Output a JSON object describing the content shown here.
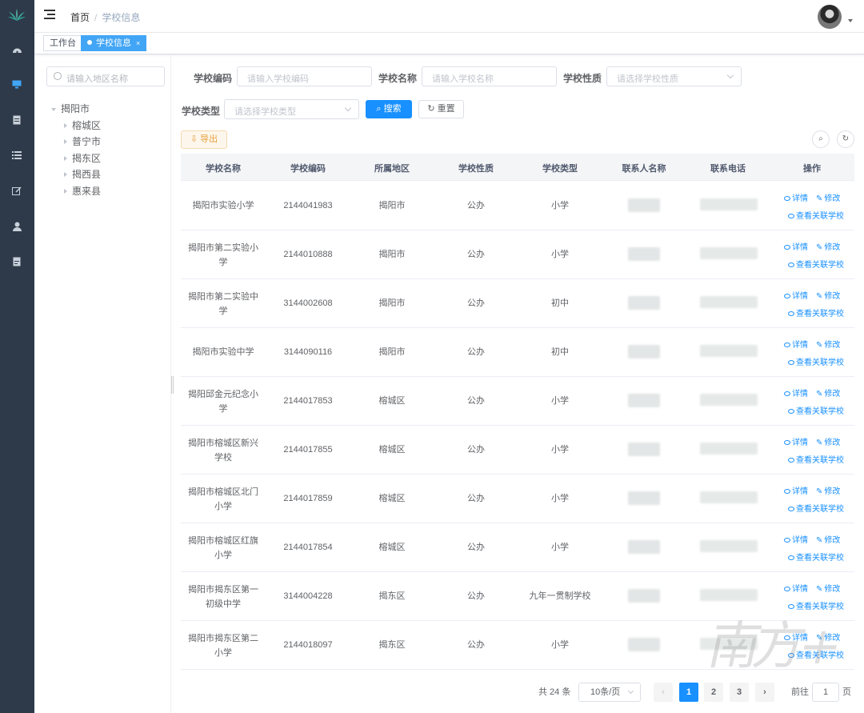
{
  "sidebar_nav": {
    "icons": [
      "dashboard-icon",
      "monitor-icon",
      "document-icon",
      "list-icon",
      "edit-icon",
      "user-icon",
      "file-icon"
    ]
  },
  "header": {
    "breadcrumb": [
      "首页",
      "学校信息"
    ]
  },
  "tags": [
    {
      "label": "工作台",
      "active": false
    },
    {
      "label": "学校信息",
      "active": true
    }
  ],
  "tree": {
    "search_placeholder": "请输入地区名称",
    "root": "揭阳市",
    "children": [
      "榕城区",
      "普宁市",
      "揭东区",
      "揭西县",
      "惠来县"
    ]
  },
  "filters": {
    "code_label": "学校编码",
    "code_placeholder": "请输入学校编码",
    "name_label": "学校名称",
    "name_placeholder": "请输入学校名称",
    "nature_label": "学校性质",
    "nature_placeholder": "请选择学校性质",
    "type_label": "学校类型",
    "type_placeholder": "请选择学校类型",
    "search_button": "搜索",
    "reset_button": "重置",
    "export_button": "导出"
  },
  "table": {
    "headers": [
      "学校名称",
      "学校编码",
      "所属地区",
      "学校性质",
      "学校类型",
      "联系人名称",
      "联系电话",
      "操作"
    ],
    "actions": {
      "detail": "详情",
      "edit": "修改",
      "related": "查看关联学校"
    },
    "rows": [
      {
        "name": "揭阳市实验小学",
        "code": "2144041983",
        "region": "揭阳市",
        "nature": "公办",
        "type": "小学"
      },
      {
        "name": "揭阳市第二实验小学",
        "code": "2144010888",
        "region": "揭阳市",
        "nature": "公办",
        "type": "小学"
      },
      {
        "name": "揭阳市第二实验中学",
        "code": "3144002608",
        "region": "揭阳市",
        "nature": "公办",
        "type": "初中"
      },
      {
        "name": "揭阳市实验中学",
        "code": "3144090116",
        "region": "揭阳市",
        "nature": "公办",
        "type": "初中"
      },
      {
        "name": "揭阳邱金元纪念小学",
        "code": "2144017853",
        "region": "榕城区",
        "nature": "公办",
        "type": "小学"
      },
      {
        "name": "揭阳市榕城区新兴学校",
        "code": "2144017855",
        "region": "榕城区",
        "nature": "公办",
        "type": "小学"
      },
      {
        "name": "揭阳市榕城区北门小学",
        "code": "2144017859",
        "region": "榕城区",
        "nature": "公办",
        "type": "小学"
      },
      {
        "name": "揭阳市榕城区红旗小学",
        "code": "2144017854",
        "region": "榕城区",
        "nature": "公办",
        "type": "小学"
      },
      {
        "name": "揭阳市揭东区第一初级中学",
        "code": "3144004228",
        "region": "揭东区",
        "nature": "公办",
        "type": "九年一贯制学校"
      },
      {
        "name": "揭阳市揭东区第二小学",
        "code": "2144018097",
        "region": "揭东区",
        "nature": "公办",
        "type": "小学"
      }
    ]
  },
  "pagination": {
    "total": "共 24 条",
    "page_size": "10条/页",
    "pages": [
      "1",
      "2",
      "3"
    ],
    "current_page": "1",
    "goto_label": "前往",
    "goto_value": "1",
    "page_suffix": "页"
  },
  "watermark": "南方+"
}
